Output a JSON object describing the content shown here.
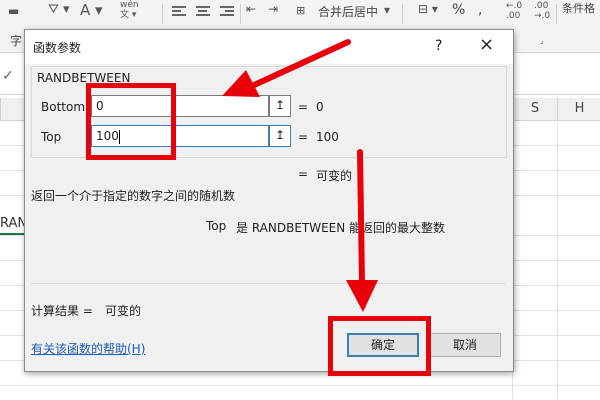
{
  "ribbon": {
    "font_a_icon": "A",
    "pinyin_icon": "wén",
    "merge_label": "合并后居中",
    "percent_label": "%",
    "comma_label": ",",
    "cond_format_label": "条件格",
    "left_char": "字"
  },
  "sheet": {
    "col_s_partial": "S",
    "col_h": "H",
    "cell_partial_text": "RAN"
  },
  "dialog": {
    "title": "函数参数",
    "help_glyph": "?",
    "close_glyph": "×",
    "function_name": "RANDBETWEEN",
    "args": [
      {
        "label": "Bottom",
        "value": "0",
        "equals": "=",
        "result": "0"
      },
      {
        "label": "Top",
        "value": "100",
        "equals": "=",
        "result": "100"
      }
    ],
    "ref_glyph": "↥",
    "overall_equals": "=",
    "overall_result": "可变的",
    "description": "返回一个介于指定的数字之间的随机数",
    "arg_desc_label": "Top",
    "arg_desc_text": "是 RANDBETWEEN 能返回的最大整数",
    "result_label": "计算结果 =",
    "result_value": "可变的",
    "help_link": "有关该函数的帮助(H)",
    "ok_label": "确定",
    "cancel_label": "取消"
  },
  "colors": {
    "annotation_red": "#e8000b",
    "link_blue": "#1a5fb4",
    "focus_blue": "#3c7fb1"
  }
}
